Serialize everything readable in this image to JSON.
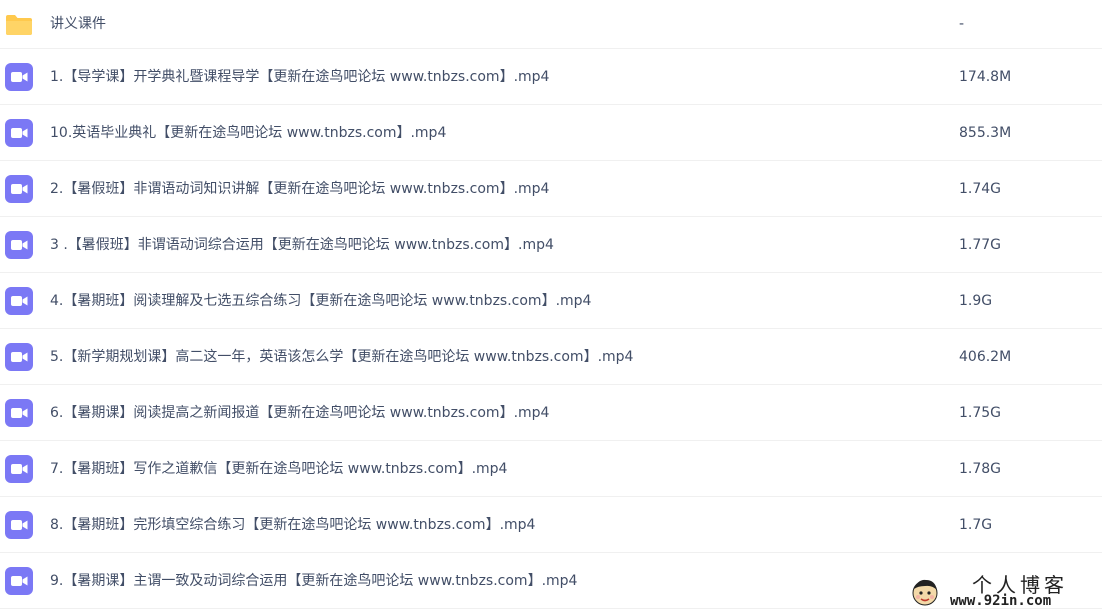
{
  "colors": {
    "folder": "#ffc94d",
    "video": "#7b78f5",
    "text": "#424e67"
  },
  "files": [
    {
      "icon": "folder-icon",
      "name": "讲义课件",
      "size": "-"
    },
    {
      "icon": "video-file-icon",
      "name": "1.【导学课】开学典礼暨课程导学【更新在途鸟吧论坛 www.tnbzs.com】.mp4",
      "size": "174.8M"
    },
    {
      "icon": "video-file-icon",
      "name": "10.英语毕业典礼【更新在途鸟吧论坛 www.tnbzs.com】.mp4",
      "size": "855.3M"
    },
    {
      "icon": "video-file-icon",
      "name": "2.【暑假班】非谓语动词知识讲解【更新在途鸟吧论坛 www.tnbzs.com】.mp4",
      "size": "1.74G"
    },
    {
      "icon": "video-file-icon",
      "name": "3 .【暑假班】非谓语动词综合运用【更新在途鸟吧论坛 www.tnbzs.com】.mp4",
      "size": "1.77G"
    },
    {
      "icon": "video-file-icon",
      "name": "4.【暑期班】阅读理解及七选五综合练习【更新在途鸟吧论坛 www.tnbzs.com】.mp4",
      "size": "1.9G"
    },
    {
      "icon": "video-file-icon",
      "name": "5.【新学期规划课】高二这一年，英语该怎么学【更新在途鸟吧论坛 www.tnbzs.com】.mp4",
      "size": "406.2M"
    },
    {
      "icon": "video-file-icon",
      "name": "6.【暑期课】阅读提高之新闻报道【更新在途鸟吧论坛 www.tnbzs.com】.mp4",
      "size": "1.75G"
    },
    {
      "icon": "video-file-icon",
      "name": "7.【暑期班】写作之道歉信【更新在途鸟吧论坛 www.tnbzs.com】.mp4",
      "size": "1.78G"
    },
    {
      "icon": "video-file-icon",
      "name": "8.【暑期班】完形填空综合练习【更新在途鸟吧论坛 www.tnbzs.com】.mp4",
      "size": "1.7G"
    },
    {
      "icon": "video-file-icon",
      "name": "9.【暑期课】主谓一致及动词综合运用【更新在途鸟吧论坛 www.tnbzs.com】.mp4",
      "size": ""
    }
  ],
  "watermark": {
    "title": "个人博客",
    "url": "www.92in.com"
  }
}
